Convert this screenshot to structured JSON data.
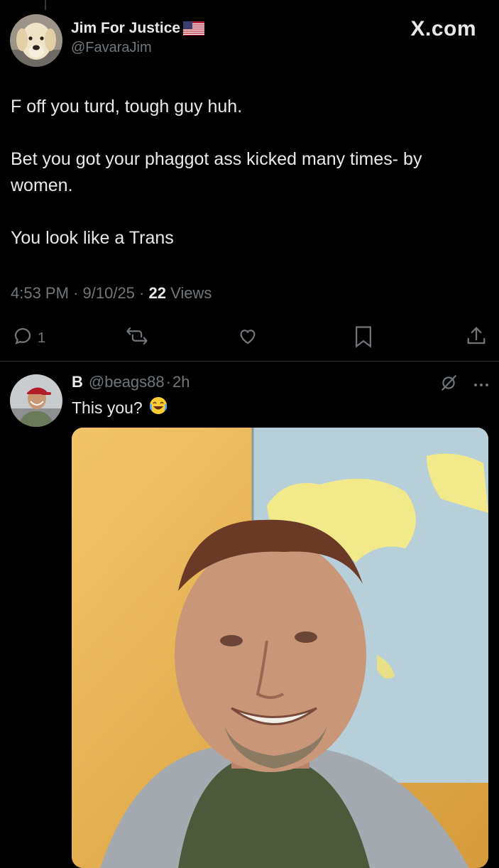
{
  "main_tweet": {
    "author": {
      "display_name": "Jim For Justice",
      "flag_icon": "us-flag-icon",
      "handle": "@FavaraJim"
    },
    "brand": "X.com",
    "body": [
      "F off you turd, tough guy huh.",
      "Bet you got your phaggot ass kicked many times- by women.",
      "You look like a Trans"
    ],
    "meta": {
      "time": "4:53 PM",
      "sep1": "·",
      "date": "9/10/25",
      "sep2": "·",
      "views_count": "22",
      "views_label": "Views"
    },
    "actions": {
      "reply_count": "1",
      "icons": [
        "reply-icon",
        "retweet-icon",
        "like-icon",
        "bookmark-icon",
        "share-icon"
      ]
    }
  },
  "reply": {
    "display_name": "B",
    "handle": "@beags88",
    "separator": "·",
    "time": "2h",
    "text": "This you?",
    "emoji": "😂",
    "icons": [
      "grok-icon",
      "more-icon"
    ]
  },
  "colors": {
    "background": "#000000",
    "text": "#e7e9ea",
    "secondary": "#71767b",
    "divider": "#2f3336"
  }
}
